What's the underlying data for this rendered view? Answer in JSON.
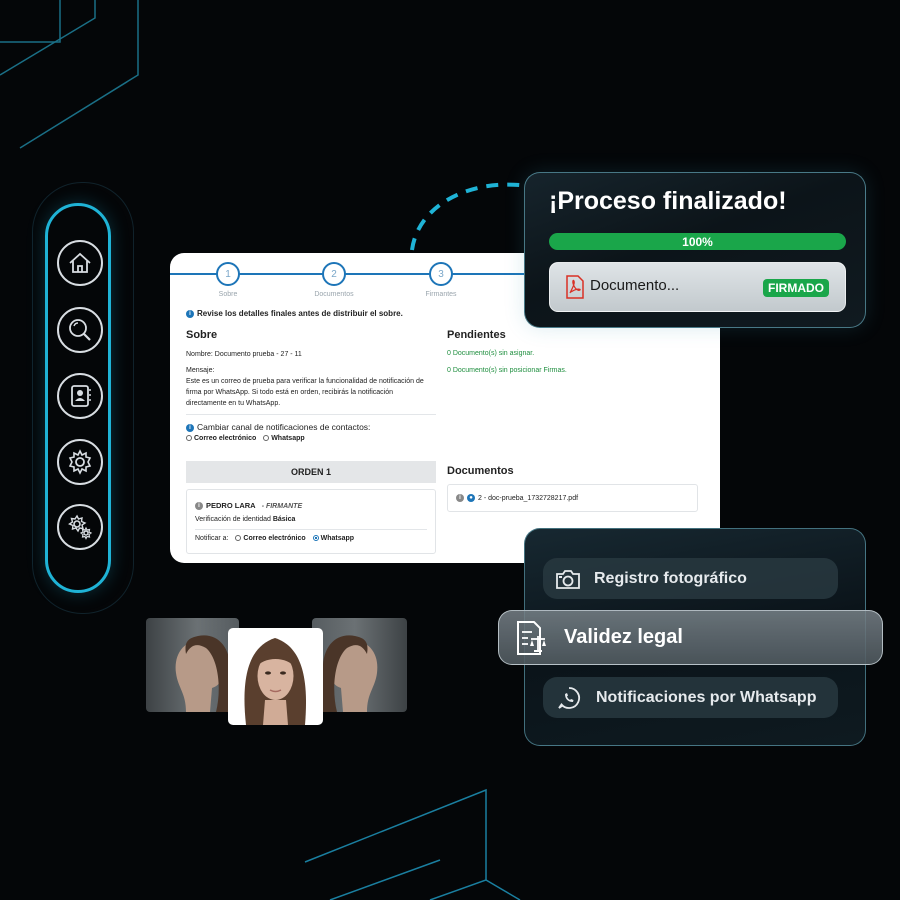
{
  "sidebar": {
    "items": [
      {
        "icon": "home-icon"
      },
      {
        "icon": "search-icon"
      },
      {
        "icon": "contacts-icon"
      },
      {
        "icon": "gear-icon"
      },
      {
        "icon": "gears-icon"
      }
    ]
  },
  "steps": [
    {
      "number": "1",
      "label": "Sobre"
    },
    {
      "number": "2",
      "label": "Documentos"
    },
    {
      "number": "3",
      "label": "Firmantes"
    }
  ],
  "review_notice": "Revise los detalles finales antes de distribuir el sobre.",
  "sobre": {
    "heading": "Sobre",
    "nombre": "Nombre: Documento prueba - 27 - 11",
    "mensaje_label": "Mensaje:",
    "mensaje_lines": [
      "Este es un correo de prueba para verificar la funcionalidad de notificación de",
      "firma por WhatsApp. Si todo está en orden, recibirás la notificación",
      "directamente en tu WhatsApp."
    ]
  },
  "pendientes": {
    "heading": "Pendientes",
    "items": [
      "0 Documento(s) sin asignar.",
      "0 Documento(s) sin posicionar Firmas."
    ]
  },
  "canal": {
    "label": "Cambiar canal de notificaciones de contactos:",
    "options": [
      "Correo electrónico",
      "Whatsapp"
    ]
  },
  "orden": {
    "title": "ORDEN 1",
    "signer_name": "PEDRO LARA",
    "signer_role": "- FIRMANTE",
    "verification_label": "Verificación de identidad",
    "verification_value": "Básica",
    "notify_label": "Notificar a:",
    "notify_options": [
      "Correo electrónico",
      "Whatsapp"
    ]
  },
  "documentos": {
    "heading": "Documentos",
    "file": "2 - doc-prueba_1732728217.pdf"
  },
  "proceso": {
    "title": "¡Proceso finalizado!",
    "progress_label": "100%",
    "progress": 1.0,
    "doc_name": "Documento...",
    "status": "FIRMADO"
  },
  "features": [
    {
      "label": "Registro fotográfico",
      "icon": "camera-icon"
    },
    {
      "label": "Validez legal",
      "icon": "legal-document-icon"
    },
    {
      "label": "Notificaciones por Whatsapp",
      "icon": "whatsapp-icon"
    }
  ],
  "colors": {
    "accent": "#1fb3d6",
    "primary_blue": "#1d75b8",
    "success": "#1aa64a",
    "background": "#040608"
  }
}
